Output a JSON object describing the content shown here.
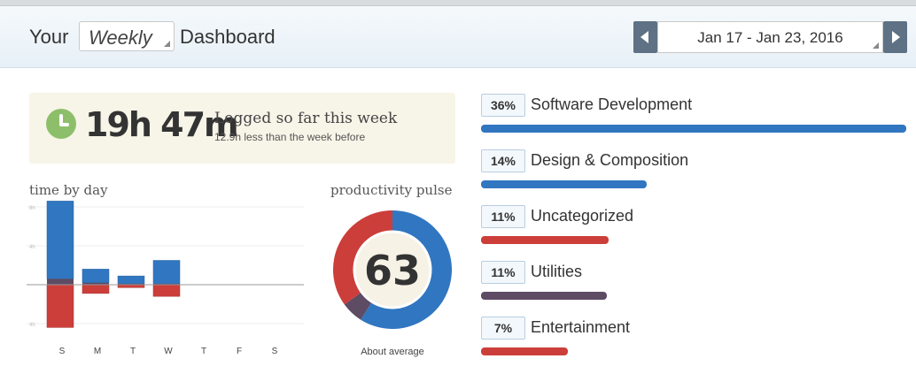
{
  "header": {
    "prefix": "Your",
    "period_select": "Weekly",
    "suffix": "Dashboard",
    "date_range": "Jan 17 - Jan 23, 2016"
  },
  "logged": {
    "time": "19h 47m",
    "label": "Logged so far this week",
    "comparison": "12.9h less than the week before"
  },
  "time_by_day": {
    "title": "time by day"
  },
  "productivity_pulse": {
    "title": "productivity pulse",
    "value": "63",
    "caption": "About average"
  },
  "categories": [
    {
      "pct": "36%",
      "name": "Software Development",
      "share": 1.0,
      "color": "#3176c0"
    },
    {
      "pct": "14%",
      "name": "Design & Composition",
      "share": 0.39,
      "color": "#3176c0"
    },
    {
      "pct": "11%",
      "name": "Uncategorized",
      "share": 0.3,
      "color": "#cc3e3a"
    },
    {
      "pct": "11%",
      "name": "Utilities",
      "share": 0.295,
      "color": "#5e4b64"
    },
    {
      "pct": "7%",
      "name": "Entertainment",
      "share": 0.205,
      "color": "#cc3e3a"
    }
  ],
  "colors": {
    "productive": "#3176c0",
    "distracting": "#cc3e3a",
    "neutral": "#5e4b64"
  },
  "chart_data": [
    {
      "type": "bar",
      "categories": [
        "S",
        "M",
        "T",
        "W",
        "T",
        "F",
        "S"
      ],
      "y_tick_labels": [
        "8h",
        "4h",
        "4h"
      ],
      "series": [
        {
          "values": [
            8.0,
            1.4,
            0.8,
            2.4,
            0,
            0,
            0
          ]
        },
        {
          "values": [
            0.6,
            0.2,
            0.1,
            0.1,
            0,
            0,
            0
          ]
        },
        {
          "values": [
            -4.4,
            -0.9,
            -0.3,
            -1.2,
            0,
            0,
            0
          ]
        }
      ]
    },
    {
      "type": "pie",
      "labels": [
        "productive",
        "neutral",
        "distracting"
      ],
      "values": [
        59,
        6,
        35
      ]
    }
  ]
}
